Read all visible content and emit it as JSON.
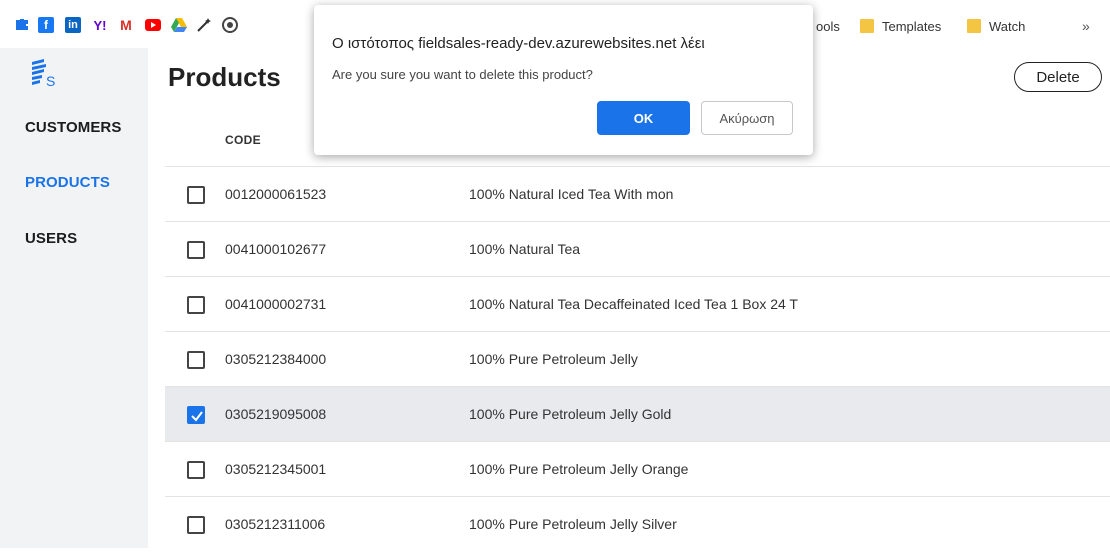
{
  "browser": {
    "bookmarks": {
      "icons": [
        "extension-icon",
        "facebook-icon",
        "linkedin-icon",
        "yahoo-icon",
        "gmail-icon",
        "youtube-icon",
        "google-drive-icon",
        "magic-wand-icon",
        "chrome-icon"
      ],
      "yahoo_label": "Y!",
      "linkedin_label": "in",
      "facebook_label": "f",
      "gmail_label": "M",
      "folders": [
        {
          "label": "ools"
        },
        {
          "label": "Templates"
        },
        {
          "label": "Watch"
        }
      ],
      "more_label": "»"
    }
  },
  "sidebar": {
    "logo_letter": "S",
    "items": [
      {
        "label": "CUSTOMERS",
        "active": false
      },
      {
        "label": "PRODUCTS",
        "active": true
      },
      {
        "label": "USERS",
        "active": false
      }
    ]
  },
  "main": {
    "title": "Products",
    "delete_label": "Delete",
    "table": {
      "headers": {
        "code": "CODE"
      },
      "rows": [
        {
          "code": "0012000061523",
          "description": "100% Natural Iced Tea With mon",
          "checked": false
        },
        {
          "code": "0041000102677",
          "description": "100% Natural Tea",
          "checked": false
        },
        {
          "code": "0041000002731",
          "description": "100% Natural Tea Decaffeinated Iced Tea 1 Box 24 T",
          "checked": false
        },
        {
          "code": "0305212384000",
          "description": "100% Pure Petroleum Jelly",
          "checked": false
        },
        {
          "code": "0305219095008",
          "description": "100% Pure Petroleum Jelly Gold",
          "checked": true
        },
        {
          "code": "0305212345001",
          "description": "100% Pure Petroleum Jelly Orange",
          "checked": false
        },
        {
          "code": "0305212311006",
          "description": "100% Pure Petroleum Jelly Silver",
          "checked": false
        }
      ]
    }
  },
  "dialog": {
    "title": "Ο ιστότοπος fieldsales-ready-dev.azurewebsites.net λέει",
    "message": "Are you sure you want to delete this product?",
    "ok_label": "OK",
    "cancel_label": "Ακύρωση"
  },
  "colors": {
    "accent": "#1a73e8",
    "sidebar_bg": "#f1f3f5",
    "selected_row_bg": "#e8eaed"
  }
}
